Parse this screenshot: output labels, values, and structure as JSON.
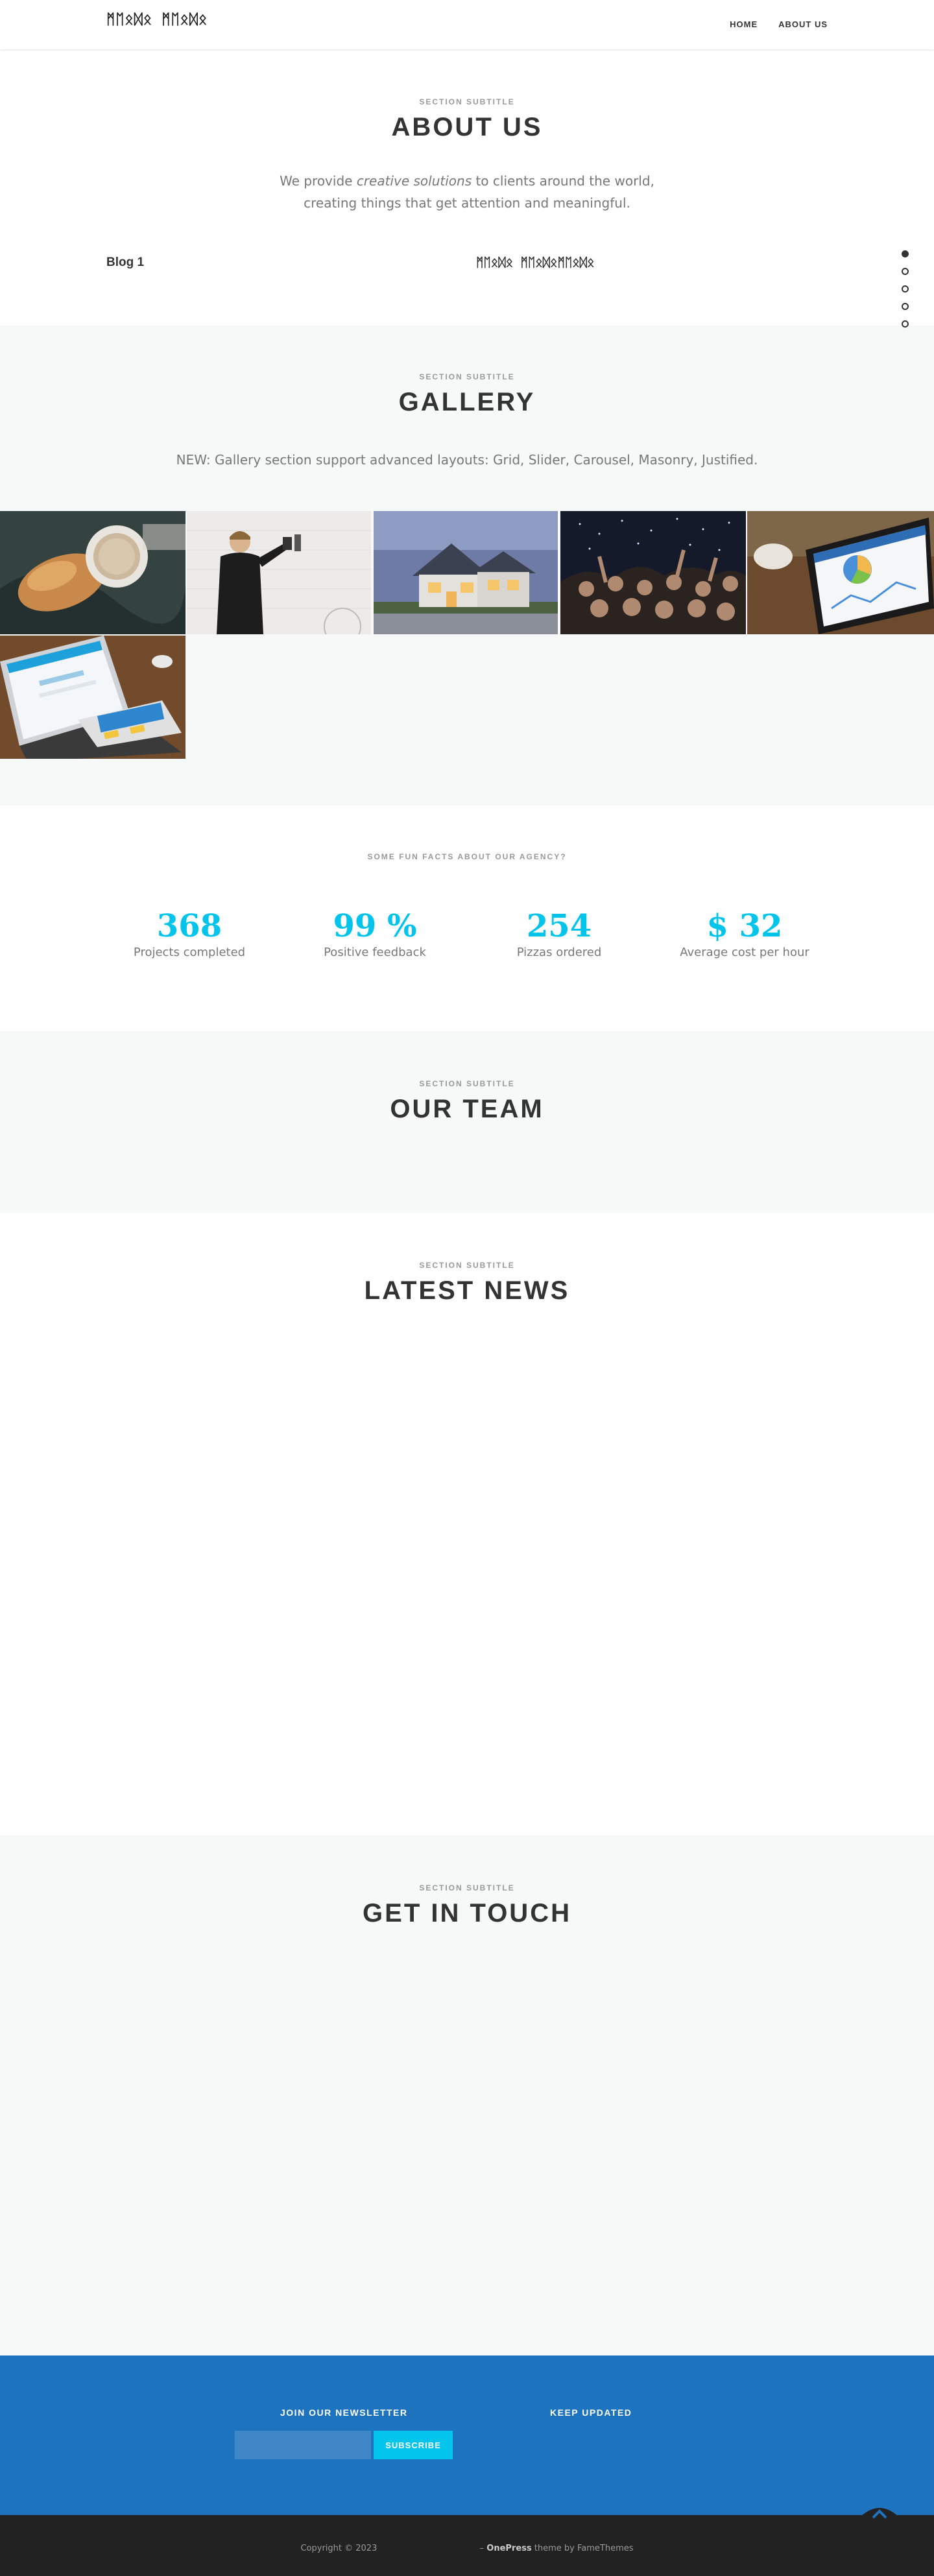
{
  "header": {
    "site_title": "ᛗᛖᛟᛞᛟ ᛗᛖᛟᛞᛟ",
    "nav": [
      "HOME",
      "ABOUT US"
    ]
  },
  "about": {
    "subtitle": "SECTION SUBTITLE",
    "title": "ABOUT US",
    "desc_prefix": "We provide ",
    "desc_em": "creative solutions",
    "desc_line1_suffix": " to clients around the world,",
    "desc_line2": "creating things that get attention and meaningful.",
    "blog_link": "Blog 1",
    "blog_link2": "ᛗᛖᛟᛞᛟ ᛗᛖᛟᛞᛟᛗᛖᛟᛞᛟ"
  },
  "gallery": {
    "subtitle": "SECTION SUBTITLE",
    "title": "GALLERY",
    "desc": "NEW: Gallery section support advanced layouts: Grid, Slider, Carousel, Masonry, Justified.",
    "images": [
      "coffee-croissant",
      "man-at-wall",
      "house-at-dusk",
      "concert-crowd",
      "tablet-dashboard",
      "laptop-desk"
    ]
  },
  "facts": {
    "heading": "SOME FUN FACTS ABOUT OUR AGENCY?",
    "items": [
      {
        "number": "368",
        "label": "Projects completed"
      },
      {
        "number": "99 %",
        "label": "Positive feedback"
      },
      {
        "number": "254",
        "label": "Pizzas ordered"
      },
      {
        "number": "$ 32",
        "label": "Average cost per hour"
      }
    ]
  },
  "team": {
    "subtitle": "SECTION SUBTITLE",
    "title": "OUR TEAM"
  },
  "news": {
    "subtitle": "SECTION SUBTITLE",
    "title": "LATEST NEWS"
  },
  "contact": {
    "subtitle": "SECTION SUBTITLE",
    "title": "GET IN TOUCH"
  },
  "footer": {
    "newsletter_title": "JOIN OUR NEWSLETTER",
    "newsletter_placeholder": "",
    "subscribe_label": "SUBSCRIBE",
    "keep_updated_title": "KEEP UPDATED",
    "copyright": "Copyright © 2023",
    "theme_sep": "– ",
    "theme_name": "OnePress",
    "theme_suffix": " theme by FameThemes"
  },
  "colors": {
    "accent": "#03c4eb",
    "footer_blue": "#1e73be",
    "footer_dark": "#222222",
    "light_bg": "#f7f8f8"
  },
  "dot_nav": {
    "count": 5,
    "active_index": 0
  }
}
